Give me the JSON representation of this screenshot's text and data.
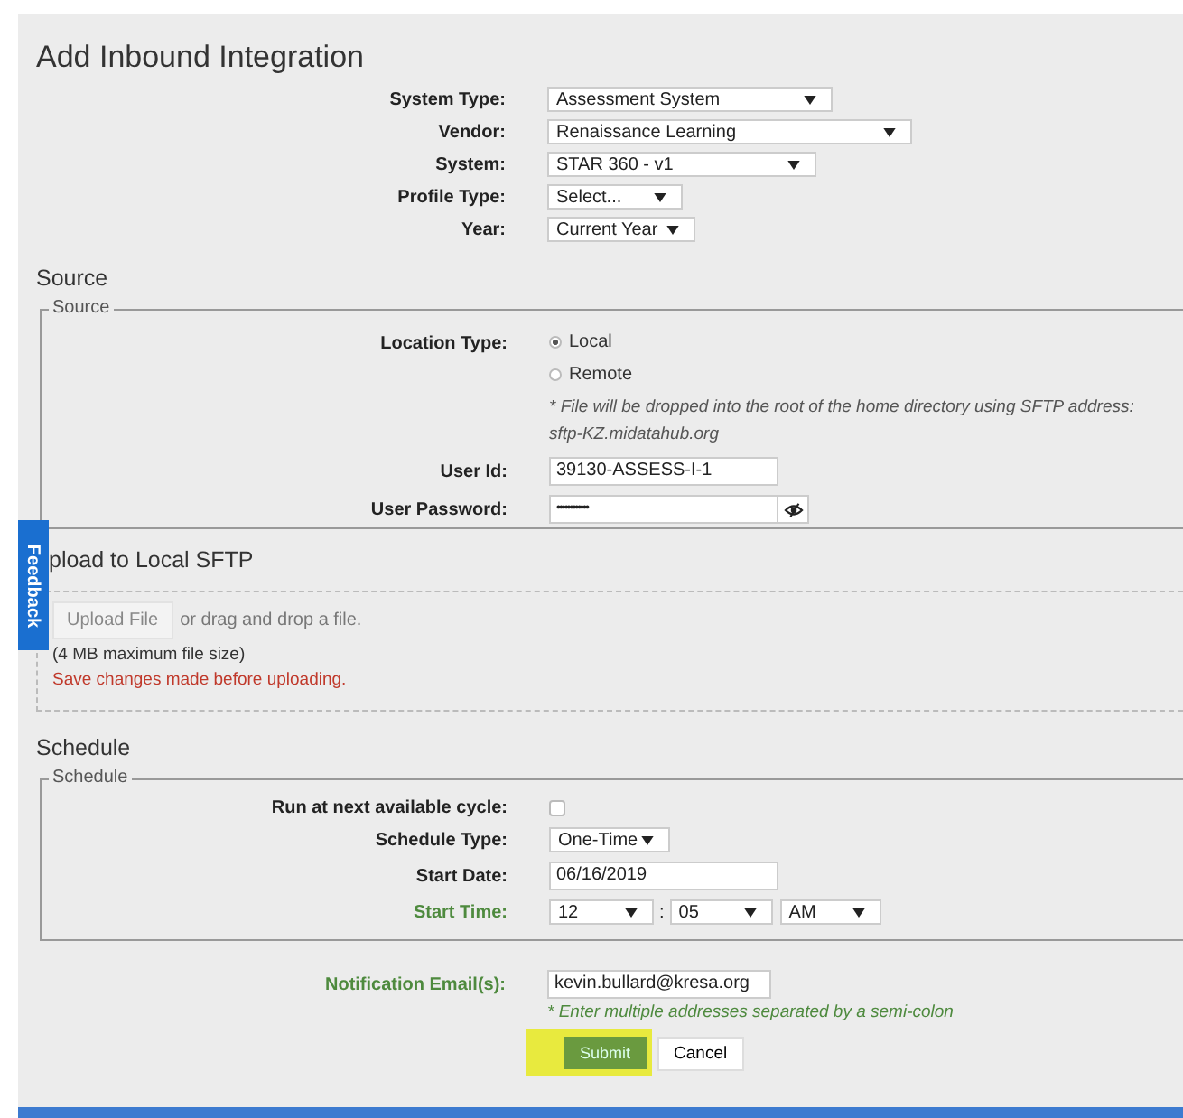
{
  "title": "Add Inbound Integration",
  "general_fields": [
    {
      "label": "System Type:",
      "value": "Assessment System"
    },
    {
      "label": "Vendor:",
      "value": "Renaissance Learning"
    },
    {
      "label": "System:",
      "value": "STAR 360 - v1"
    },
    {
      "label": "Profile Type:",
      "value": "Select..."
    },
    {
      "label": "Year:",
      "value": "Current Year"
    }
  ],
  "source": {
    "heading": "Source",
    "legend": "Source",
    "location_label": "Location Type:",
    "location_options": [
      {
        "label": "Local",
        "selected": true
      },
      {
        "label": "Remote",
        "selected": false
      }
    ],
    "note": "* File will be dropped into the root of the home directory using SFTP address: sftp-KZ.midatahub.org",
    "user_id_label": "User Id:",
    "user_id": "39130-ASSESS-I-1",
    "password_label": "User Password:",
    "password": "••••••••••••"
  },
  "upload": {
    "heading": "pload to Local SFTP",
    "button": "Upload File",
    "drop_hint": "or drag and drop a file.",
    "size_note": "(4 MB maximum file size)",
    "warning": "Save changes made before uploading."
  },
  "feedback_tab": "Feedback",
  "schedule": {
    "heading": "Schedule",
    "legend": "Schedule",
    "run_next_label": "Run at next available cycle:",
    "run_next_checked": false,
    "type_label": "Schedule Type:",
    "type_value": "One-Time",
    "date_label": "Start Date:",
    "date_value": "06/16/2019",
    "time_label": "Start Time:",
    "time_label_valid": true,
    "time_hour": "12",
    "time_sep": ":",
    "time_minute": "05",
    "time_ampm": "AM"
  },
  "email_label": "Notification Email(s):",
  "email_label_valid": true,
  "email": "kevin.bullard@kresa.org",
  "email_hint": "* Enter multiple addresses separated by a semi-colon",
  "buttons": {
    "submit": "Submit",
    "submit_highlighted": true,
    "cancel": "Cancel"
  }
}
